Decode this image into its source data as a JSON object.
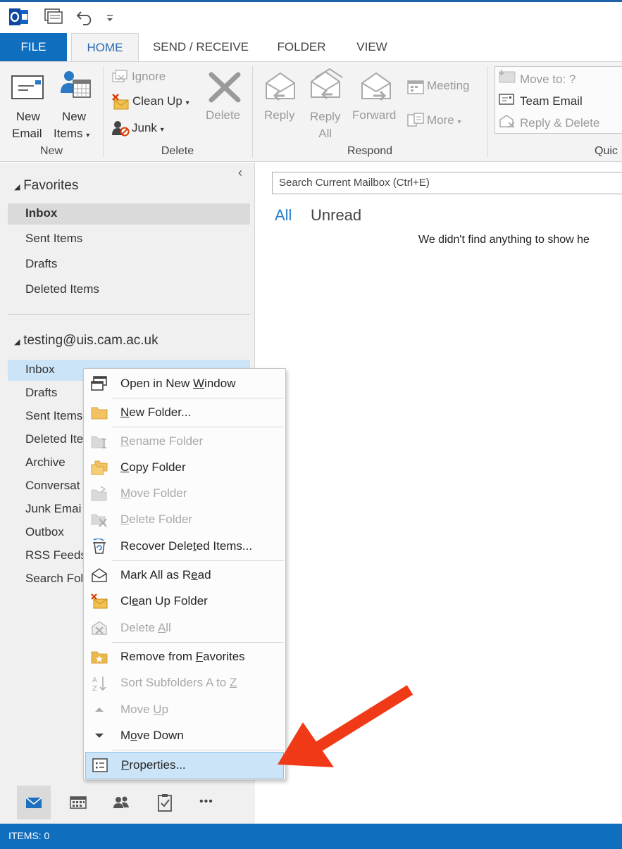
{
  "ribbon_tabs": [
    "FILE",
    "HOME",
    "SEND / RECEIVE",
    "FOLDER",
    "VIEW"
  ],
  "ribbon": {
    "new_email": [
      "New",
      "Email"
    ],
    "new_items": [
      "New",
      "Items"
    ],
    "ignore": "Ignore",
    "clean_up": "Clean Up",
    "junk": "Junk",
    "delete": "Delete",
    "reply": "Reply",
    "reply_all": [
      "Reply",
      "All"
    ],
    "forward": "Forward",
    "meeting": "Meeting",
    "more": "More",
    "move_to": "Move to: ?",
    "team_email": "Team Email",
    "reply_delete": "Reply & Delete",
    "groups": {
      "new": "New",
      "delete": "Delete",
      "respond": "Respond",
      "quick": "Quic"
    }
  },
  "nav": {
    "collapse_arrow": "‹",
    "favorites_header": "Favorites",
    "favorites": [
      "Inbox",
      "Sent Items",
      "Drafts",
      "Deleted Items"
    ],
    "account_header": "testing@uis.cam.ac.uk",
    "account_folders": [
      "Inbox",
      "Drafts",
      "Sent Items",
      "Deleted Ite",
      "Archive",
      "Conversat",
      "Junk Emai",
      "Outbox",
      "RSS Feeds",
      "Search Fol"
    ],
    "bottom_icons": [
      "mail-icon",
      "calendar-icon",
      "people-icon",
      "tasks-icon",
      "more-icon"
    ],
    "more_dots": "•••"
  },
  "main": {
    "search_placeholder": "Search Current Mailbox (Ctrl+E)",
    "filter_all": "All",
    "filter_unread": "Unread",
    "empty_message": "We didn't find anything to show he"
  },
  "status": {
    "items": "ITEMS: 0"
  },
  "context_menu": {
    "items": [
      {
        "label": "Open in New Window",
        "accel": "W",
        "enabled": true
      },
      {
        "label": "New Folder...",
        "accel": "N",
        "enabled": true
      },
      {
        "label": "Rename Folder",
        "accel": "R",
        "enabled": false
      },
      {
        "label": "Copy Folder",
        "accel": "C",
        "enabled": true
      },
      {
        "label": "Move Folder",
        "accel": "M",
        "enabled": false
      },
      {
        "label": "Delete Folder",
        "accel": "D",
        "enabled": false
      },
      {
        "label": "Recover Deleted Items...",
        "accel": "t",
        "enabled": true
      },
      {
        "label": "Mark All as Read",
        "accel": "e",
        "enabled": true
      },
      {
        "label": "Clean Up Folder",
        "accel": "e",
        "enabled": true
      },
      {
        "label": "Delete All",
        "accel": "A",
        "enabled": false
      },
      {
        "label": "Remove from Favorites",
        "accel": "F",
        "enabled": true
      },
      {
        "label": "Sort Subfolders A to Z",
        "accel": "Z",
        "enabled": false
      },
      {
        "label": "Move Up",
        "accel": "U",
        "enabled": false
      },
      {
        "label": "Move Down",
        "accel": "o",
        "enabled": true
      },
      {
        "label": "Properties...",
        "accel": "P",
        "enabled": true,
        "highlighted": true
      }
    ]
  },
  "colors": {
    "accent": "#106ebe",
    "selection": "#cce4f7",
    "annotation_arrow": "#f03a17"
  }
}
